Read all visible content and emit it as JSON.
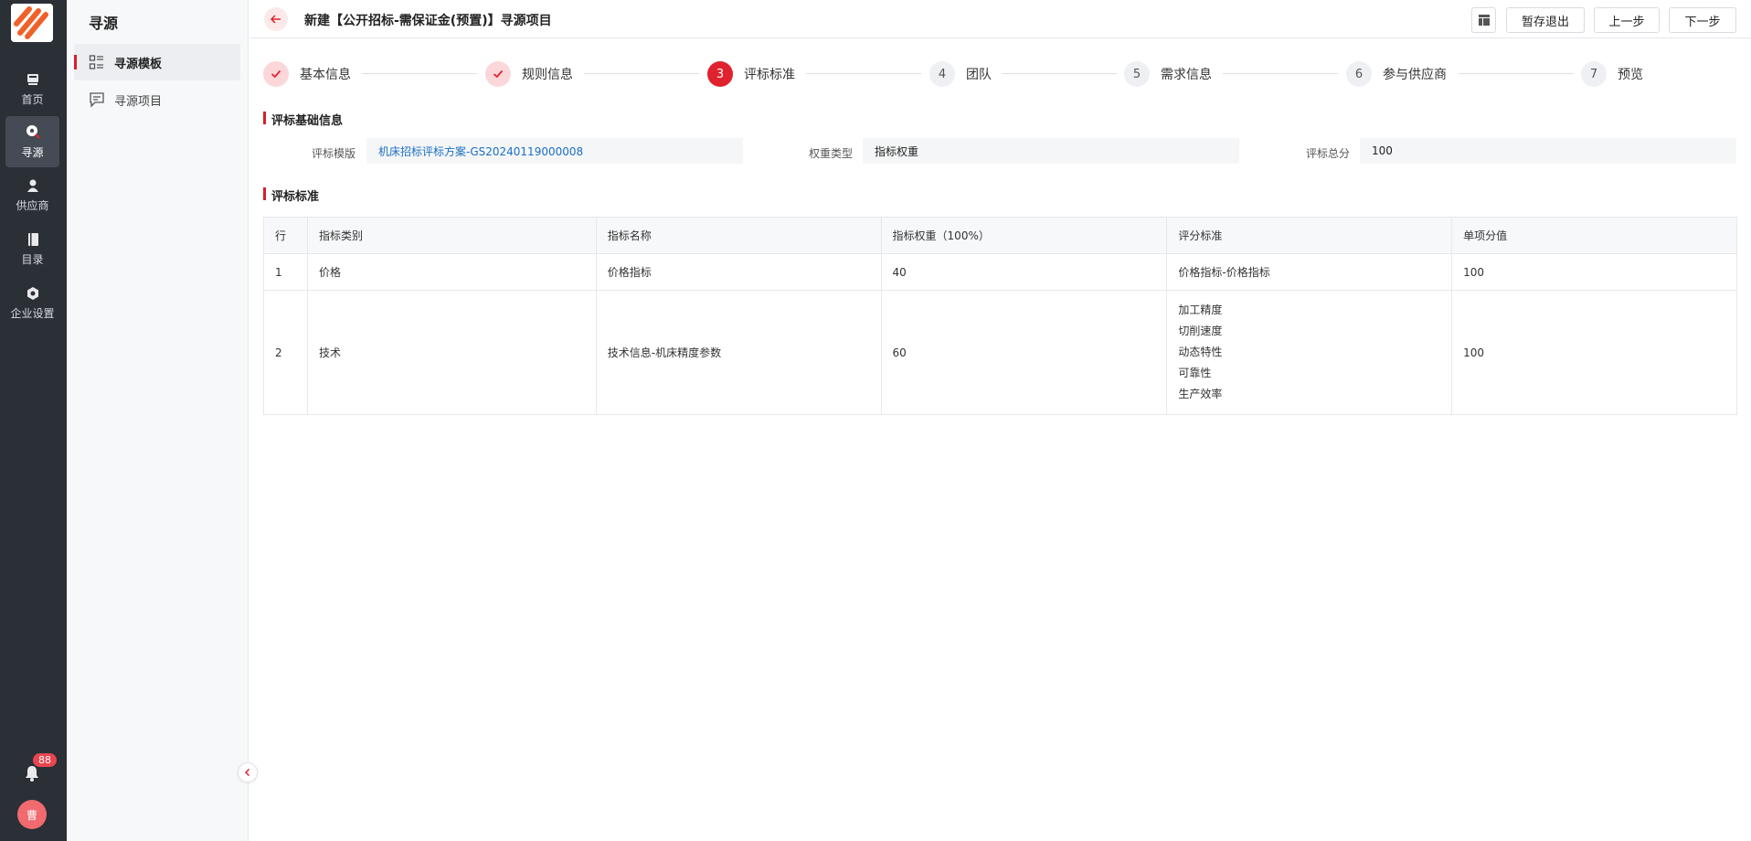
{
  "nav": {
    "items": [
      {
        "label": "首页",
        "icon": "home-icon"
      },
      {
        "label": "寻源",
        "icon": "sourcing-icon"
      },
      {
        "label": "供应商",
        "icon": "supplier-icon"
      },
      {
        "label": "目录",
        "icon": "catalog-icon"
      },
      {
        "label": "企业设置",
        "icon": "settings-icon"
      }
    ],
    "notification_count": "88",
    "avatar_text": "曹"
  },
  "sidebar": {
    "title": "寻源",
    "items": [
      {
        "label": "寻源模板",
        "icon": "template-list-icon"
      },
      {
        "label": "寻源项目",
        "icon": "project-chat-icon"
      }
    ]
  },
  "header": {
    "title": "新建【公开招标-需保证金(预置)】寻源项目",
    "buttons": {
      "save_exit": "暂存退出",
      "prev": "上一步",
      "next": "下一步"
    }
  },
  "steps": [
    {
      "num": "1",
      "label": "基本信息",
      "status": "done"
    },
    {
      "num": "2",
      "label": "规则信息",
      "status": "done"
    },
    {
      "num": "3",
      "label": "评标标准",
      "status": "current"
    },
    {
      "num": "4",
      "label": "团队",
      "status": "todo"
    },
    {
      "num": "5",
      "label": "需求信息",
      "status": "todo"
    },
    {
      "num": "6",
      "label": "参与供应商",
      "status": "todo"
    },
    {
      "num": "7",
      "label": "预览",
      "status": "todo"
    }
  ],
  "basic": {
    "title": "评标基础信息",
    "template_label": "评标模版",
    "template_value": "机床招标评标方案-GS20240119000008",
    "weight_label": "权重类型",
    "weight_value": "指标权重",
    "total_label": "评标总分",
    "total_value": "100"
  },
  "criteria": {
    "title": "评标标准",
    "columns": [
      "行",
      "指标类别",
      "指标名称",
      "指标权重（100%）",
      "评分标准",
      "单项分值"
    ],
    "rows": [
      {
        "row": "1",
        "category": "价格",
        "name": "价格指标",
        "weight": "40",
        "standards": [
          "价格指标-价格指标"
        ],
        "score": "100"
      },
      {
        "row": "2",
        "category": "技术",
        "name": "技术信息-机床精度参数",
        "weight": "60",
        "standards": [
          "加工精度",
          "切削速度",
          "动态特性",
          "可靠性",
          "生产效率"
        ],
        "score": "100"
      }
    ]
  },
  "colors": {
    "accent": "#e0222e",
    "rail": "#2b2f36",
    "link": "#1a6fc4"
  }
}
